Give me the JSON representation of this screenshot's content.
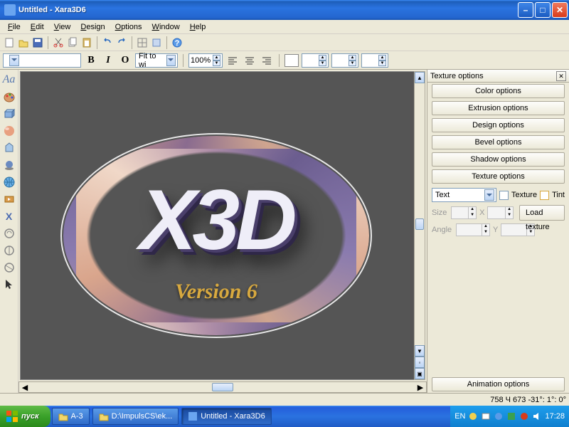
{
  "titlebar": {
    "title": "Untitled - Xara3D6"
  },
  "menu": {
    "file": "File",
    "edit": "Edit",
    "view": "View",
    "design": "Design",
    "options": "Options",
    "window": "Window",
    "help": "Help"
  },
  "formatbar": {
    "font": "",
    "bold": "B",
    "italic": "I",
    "oblique": "O",
    "fitmode": "Fit to wi",
    "zoom": "100%"
  },
  "panel": {
    "header": "Texture options",
    "color": "Color options",
    "extrusion": "Extrusion options",
    "design": "Design options",
    "bevel": "Bevel options",
    "shadow": "Shadow options",
    "texture": "Texture options",
    "apply_to": "Text",
    "chk_texture": "Texture",
    "chk_tint": "Tint",
    "lbl_size": "Size",
    "lbl_angle": "Angle",
    "lbl_x": "X",
    "lbl_y": "Y",
    "loadtex": "Load texture",
    "animation": "Animation options"
  },
  "logo": {
    "main": "X3D",
    "sub": "Version 6"
  },
  "status": {
    "coords": "758 Ч 673  -31°: 1°: 0°"
  },
  "taskbar": {
    "start": "пуск",
    "task1": "A-3",
    "task2": "D:\\ImpulsCS\\ek...",
    "task3": "Untitled - Xara3D6",
    "lang": "EN",
    "time": "17:28"
  }
}
